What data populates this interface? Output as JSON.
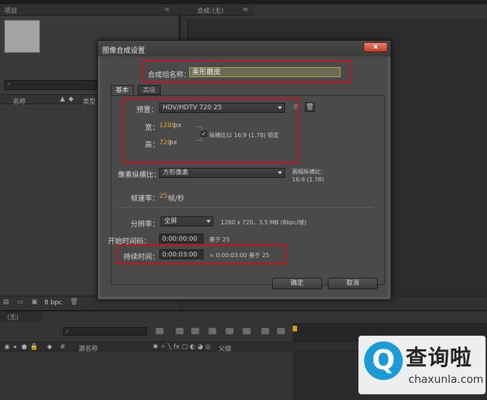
{
  "background": {
    "project_tab": "项目",
    "comp_tab": "合成:(无)",
    "project_columns": [
      "名称",
      "类型"
    ],
    "bpc": "8 bpc",
    "timeline_tab": "(无)",
    "timeline_columns": [
      "源名称",
      "父级"
    ]
  },
  "dialog": {
    "title": "图像合成设置",
    "close": "x",
    "name_label": "合成组名称：",
    "name_value": "美形磨皮",
    "tabs": [
      "基本",
      "高级"
    ],
    "preset_label": "预置：",
    "preset_value": "HDV/HDTV 720 25",
    "width_label": "宽：",
    "width_value": "1280",
    "height_label": "高：",
    "height_value": "720",
    "unit_px": "px",
    "lock_label": "纵横比以 16:9 (1.78) 锁定",
    "pixel_aspect_label": "像素纵横比：",
    "pixel_aspect_value": "方形像素",
    "frame_aspect_label": "画幅纵横比：",
    "frame_aspect_value": "16:9 (1.78)",
    "frame_rate_label": "帧速率：",
    "frame_rate_value": "25",
    "frame_rate_unit": "帧/秒",
    "resolution_label": "分辨率：",
    "resolution_value": "全屏",
    "resolution_info": "1280 x 720，3.5 MB (8bpc/帧)",
    "start_tc_label": "开始时间码：",
    "start_tc_value": "0:00:00:00",
    "start_tc_info": "基于 25",
    "duration_label": "持续时间：",
    "duration_value": "0:00:03:00",
    "duration_info": "= 0:00:03:00  基于 25",
    "ok_button": "确定",
    "cancel_button": "取消"
  },
  "watermark": {
    "logo_letter": "Q",
    "name": "查询啦",
    "url": "chaxunla.com"
  },
  "colors": {
    "highlight_box": "#c4141f",
    "accent_value": "#e0a030",
    "watermark_blue": "#1a9ad6"
  }
}
